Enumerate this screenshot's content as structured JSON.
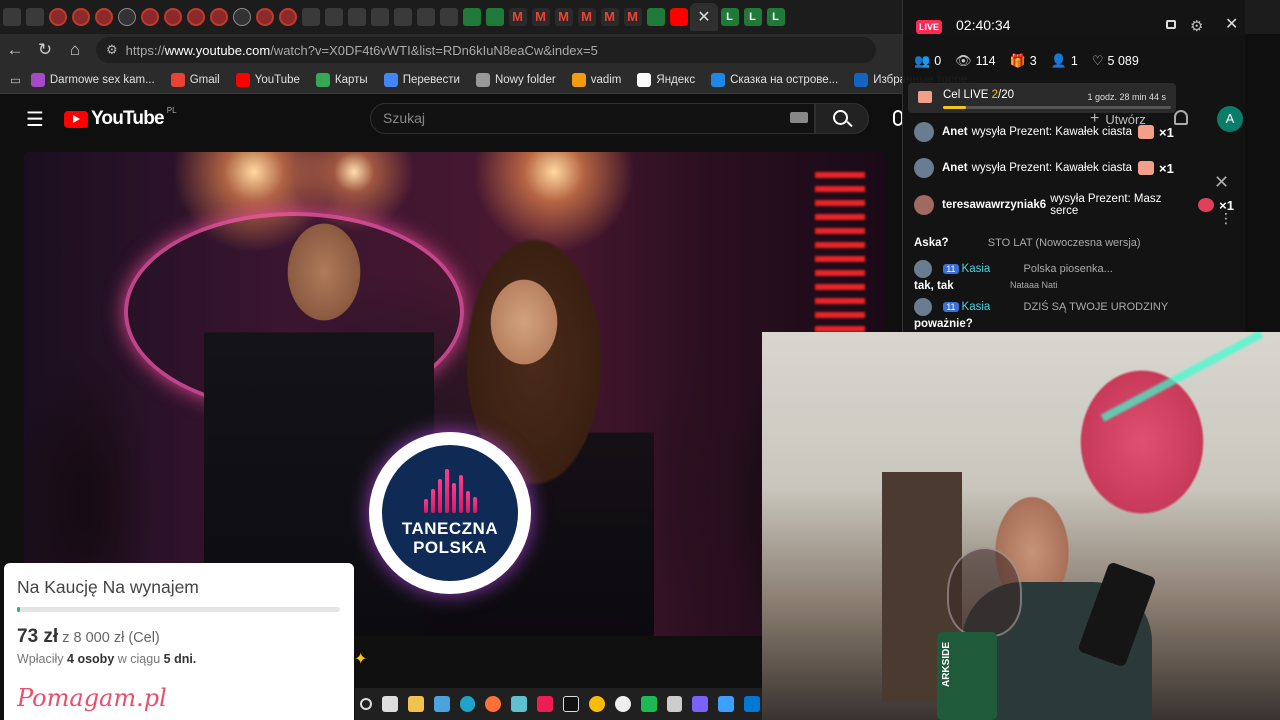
{
  "browser": {
    "url_prefix": "https://",
    "url_host": "www.youtube.com",
    "url_path": "/watch?v=X0DF4t6vWTI&list=RDn6kIuN8eaCw&index=5",
    "bookmarks": [
      {
        "label": "Darmowe sex kam...",
        "color": "#a74ac7"
      },
      {
        "label": "Gmail",
        "color": "#ea4335"
      },
      {
        "label": "YouTube",
        "color": "#ff0000"
      },
      {
        "label": "Карты",
        "color": "#34a853"
      },
      {
        "label": "Перевести",
        "color": "#4285f4"
      },
      {
        "label": "Nowy folder",
        "color": "#999999"
      },
      {
        "label": "vadim",
        "color": "#f39c12"
      },
      {
        "label": "Яндекс",
        "color": "#ffffff"
      },
      {
        "label": "Сказка на острове...",
        "color": "#1e88e5"
      },
      {
        "label": "Избранные торре...",
        "color": "#1565c0"
      }
    ]
  },
  "youtube": {
    "logo_text": "YouTube",
    "region": "PL",
    "search_placeholder": "Szukaj",
    "create_label": "Utwórz",
    "avatar_letter": "A"
  },
  "video": {
    "logo_line1": "TANECZNA",
    "logo_line2": "POLSKA"
  },
  "donation": {
    "title": "Na Kaucję Na wynajem",
    "amount": "73 zł",
    "goal_text": "z 8 000 zł (Cel)",
    "progress": 0.009,
    "meta_prefix": "Wpłaciły",
    "donors": "4 osoby",
    "meta_mid": "w ciągu",
    "days": "5 dni.",
    "brand": "Pomagam.pl"
  },
  "live": {
    "badge": "LIVE",
    "time": "02:40:34",
    "stats": {
      "users": "0",
      "viewers": "114",
      "gifts": "3",
      "follows": "1",
      "likes": "5 089"
    },
    "goal_label": "Cel LIVE",
    "goal_current": "2",
    "goal_total": "/20",
    "goal_progress": 0.1,
    "goal_time": "1 godz. 28 min 44 s",
    "gifts": [
      {
        "user": "Anet",
        "text": "wysyła Prezent: Kawałek ciasta",
        "count": "×1"
      },
      {
        "user": "Anet",
        "text": "wysyła Prezent: Kawałek ciasta",
        "count": "×1"
      },
      {
        "user": "teresawawrzyniak6",
        "text": "wysyła Prezent: Masz serce",
        "count": "×1"
      }
    ],
    "chat": [
      {
        "text": "Aska?"
      },
      {
        "level": "11",
        "name": "Kasia",
        "text": "tak, tak"
      },
      {
        "level": "11",
        "name": "Kasia",
        "text": "poważnie?"
      }
    ],
    "bg_playlist": [
      "STO LAT (Nowoczesna wersja)",
      "Polska piosenka...",
      "DZIŚ SĄ TWOJE URODZINY",
      "Nataaa Nati"
    ]
  },
  "webcam": {
    "mug_text": "ARKSIDE"
  }
}
